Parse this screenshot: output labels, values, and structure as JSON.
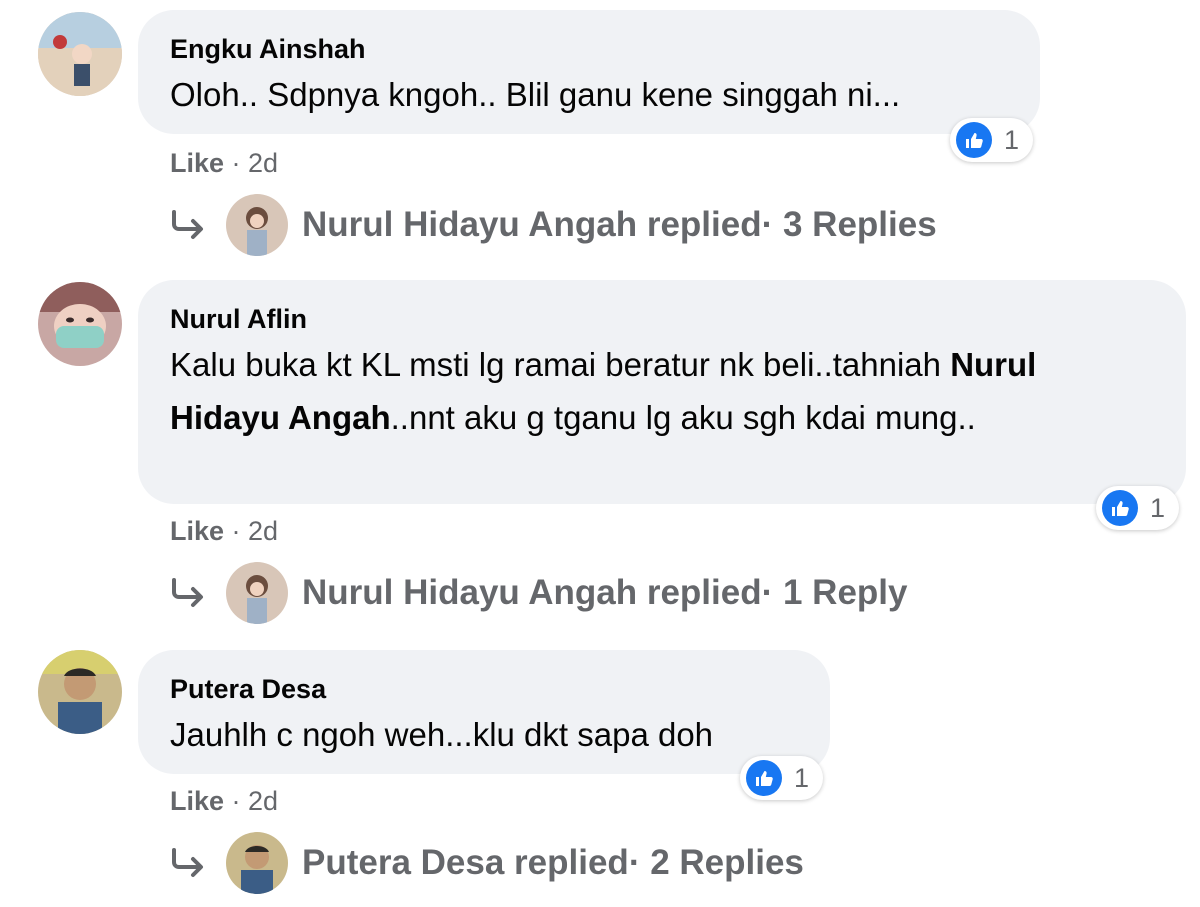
{
  "comments": [
    {
      "author": "Engku Ainshah",
      "text": "Oloh.. Sdpnya kngoh.. Blil ganu kene singgah ni...",
      "reaction_count": "1",
      "like_label": "Like",
      "time": " · 2d",
      "replier": "Nurul Hidayu Angah replied",
      "replies_label": " · 3 Replies"
    },
    {
      "author": "Nurul Aflin",
      "text_before": "Kalu buka kt KL msti lg ramai beratur nk beli..tahniah ",
      "mention": "Nurul Hidayu Angah",
      "text_after": "..nnt aku g tganu lg aku sgh kdai mung..",
      "reaction_count": "1",
      "like_label": "Like",
      "time": " · 2d",
      "replier": "Nurul Hidayu Angah replied",
      "replies_label": " · 1 Reply"
    },
    {
      "author": "Putera Desa",
      "text": "Jauhlh c ngoh weh...klu dkt sapa doh",
      "reaction_count": "1",
      "like_label": "Like",
      "time": " · 2d",
      "replier": "Putera Desa replied",
      "replies_label": " · 2 Replies"
    }
  ],
  "colors": {
    "bubble": "#f0f2f5",
    "secondary_text": "#65676b",
    "like_blue": "#1877f2"
  }
}
